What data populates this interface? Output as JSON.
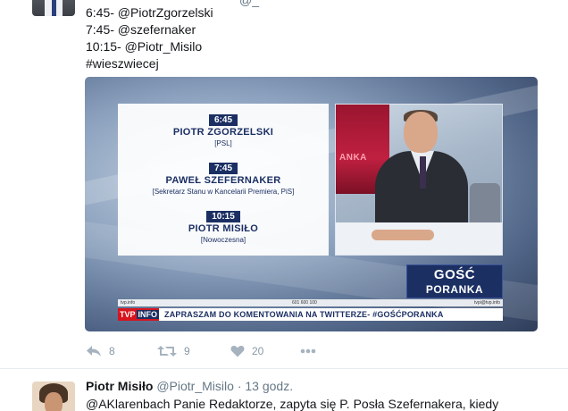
{
  "top_tweet": {
    "handle_fragment": "@_",
    "lines": [
      "6:45- @PiotrZgorzelski",
      "7:45- @szefernaker",
      "10:15- @Piotr_Misilo",
      "#wieszwiecej"
    ],
    "media": {
      "schedule": [
        {
          "time": "6:45",
          "name": "PIOTR ZGORZELSKI",
          "party": "[PSL]"
        },
        {
          "time": "7:45",
          "name": "PAWEŁ SZEFERNAKER",
          "party": "[Sekretarz Stanu w Kancelarii Premiera, PiS]"
        },
        {
          "time": "10:15",
          "name": "PIOTR MISIŁO",
          "party": "[Nowoczesna]"
        }
      ],
      "screen_text": "ANKA",
      "gosc_line1": "GOŚĆ",
      "gosc_line2": "PORANKA",
      "info_left": "tvp.info",
      "info_mid": "601 600 100",
      "info_right": "tvpi@tvp.info",
      "ticker_logo_a": "TVP",
      "ticker_logo_b": "INFO",
      "ticker_text": "ZAPRASZAM DO KOMENTOWANIA NA TWITTERZE- #GOŚĆPORANKA"
    },
    "actions": {
      "reply": {
        "icon": "reply-icon",
        "count": "8"
      },
      "retweet": {
        "icon": "retweet-icon",
        "count": "9"
      },
      "like": {
        "icon": "heart-icon",
        "count": "20"
      },
      "more": {
        "icon": "more-icon"
      }
    }
  },
  "bottom_tweet": {
    "name": "Piotr Misiło",
    "handle": "@Piotr_Misilo",
    "dot": "·",
    "time": "13 godz.",
    "text": "@AKlarenbach Panie Redaktorze, zapyta się P. Posła Szefernakera, kiedy"
  },
  "colors": {
    "tvp_navy": "#1b2f63",
    "tvp_red": "#d7141d",
    "action_gray": "#8899a6",
    "handle_gray": "#657786"
  }
}
